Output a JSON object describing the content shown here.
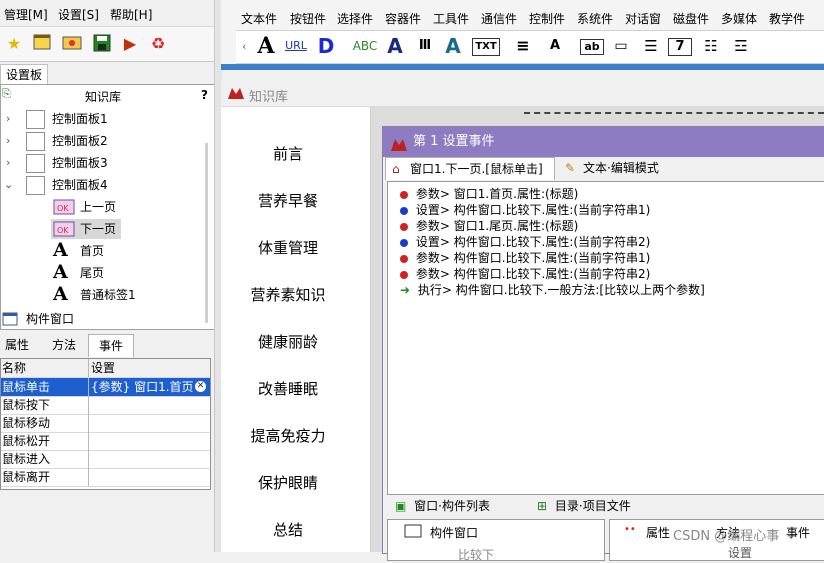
{
  "menubar": {
    "items": [
      "管理[M]",
      "设置[S]",
      "帮助[H]"
    ]
  },
  "left_tab": "设置板",
  "tree": {
    "header": "知识库",
    "help": "?",
    "rows": [
      {
        "label": "控制面板1",
        "kind": "panel"
      },
      {
        "label": "控制面板2",
        "kind": "panel"
      },
      {
        "label": "控制面板3",
        "kind": "panel"
      },
      {
        "label": "控制面板4",
        "kind": "panel"
      },
      {
        "label": "上一页",
        "kind": "button"
      },
      {
        "label": "下一页",
        "kind": "button"
      },
      {
        "label": "首页",
        "kind": "text"
      },
      {
        "label": "尾页",
        "kind": "text"
      },
      {
        "label": "普通标签1",
        "kind": "text"
      }
    ],
    "footer": "构件窗口"
  },
  "prop_tabs": [
    "属性",
    "方法",
    "事件"
  ],
  "prop_grid": {
    "col_name": "名称",
    "col_value": "设置",
    "rows": [
      {
        "name": "鼠标单击",
        "value": "{参数} 窗口1.首页",
        "selected": true
      },
      {
        "name": "鼠标按下",
        "value": ""
      },
      {
        "name": "鼠标移动",
        "value": ""
      },
      {
        "name": "鼠标松开",
        "value": ""
      },
      {
        "name": "鼠标进入",
        "value": ""
      },
      {
        "name": "鼠标离开",
        "value": ""
      }
    ]
  },
  "ribbon_tabs": [
    "文本件",
    "按钮件",
    "选择件",
    "容器件",
    "工具件",
    "通信件",
    "控制件",
    "系统件",
    "对话窗",
    "磁盘件",
    "多媒体",
    "教学件"
  ],
  "ribbon_icons": [
    {
      "glyph": "A",
      "name": "text-a-icon"
    },
    {
      "glyph": "URL",
      "name": "url-icon"
    },
    {
      "glyph": "D",
      "name": "d-icon"
    },
    {
      "glyph": "ABC",
      "name": "abc-icon"
    },
    {
      "glyph": "A",
      "name": "outline-a-icon"
    },
    {
      "glyph": "Ⅲ",
      "name": "barcode-icon"
    },
    {
      "glyph": "A",
      "name": "art-text-icon"
    },
    {
      "glyph": "TXT",
      "name": "txt-icon"
    },
    {
      "glyph": "≡",
      "name": "list-icon"
    },
    {
      "glyph": "A",
      "name": "small-a-icon"
    },
    {
      "glyph": "ab",
      "name": "input-box-icon"
    },
    {
      "glyph": "▭",
      "name": "field-icon"
    },
    {
      "glyph": "☰",
      "name": "memo-icon"
    },
    {
      "glyph": "7",
      "name": "number-icon"
    },
    {
      "glyph": "☷",
      "name": "doc-icon"
    },
    {
      "glyph": "☲",
      "name": "table-icon"
    }
  ],
  "kb_title": "知识库",
  "nav_items": [
    "前言",
    "营养早餐",
    "体重管理",
    "营养素知识",
    "健康丽龄",
    "改善睡眠",
    "提高免疫力",
    "保护眼睛",
    "总结"
  ],
  "dialog": {
    "title": "第 1 设置事件",
    "tab1": "窗口1.下一页.[鼠标单击]",
    "tab2": "文本·编辑模式",
    "lines": [
      {
        "text": "参数> 窗口1.首页.属性:(标题)",
        "color": "#d42020"
      },
      {
        "text": "设置> 构件窗口.比较下.属性:(当前字符串1)",
        "color": "#1c3cc8"
      },
      {
        "text": "参数> 窗口1.尾页.属性:(标题)",
        "color": "#d42020"
      },
      {
        "text": "设置> 构件窗口.比较下.属性:(当前字符串2)",
        "color": "#1c3cc8"
      },
      {
        "text": "参数> 构件窗口.比较下.属性:(当前字符串1)",
        "color": "#d42020"
      },
      {
        "text": "参数> 构件窗口.比较下.属性:(当前字符串2)",
        "color": "#d42020"
      },
      {
        "text": "执行> 构件窗口.比较下.一般方法:[比较以上两个参数]",
        "color": "#1a8a1a"
      }
    ],
    "bottom_tab1": "窗口·构件列表",
    "bottom_tab2": "目录·项目文件",
    "component_window": "构件窗口",
    "component_sub": "比较下",
    "right_tabs": [
      "属性",
      "方法",
      "事件"
    ],
    "right_col": "设置",
    "watermark": "CSDN @编程心事"
  }
}
